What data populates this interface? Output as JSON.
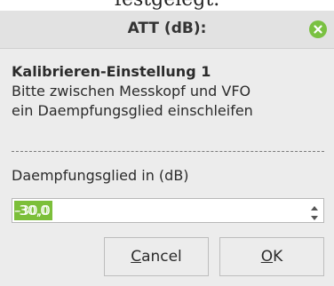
{
  "background_text": "festgelegt.",
  "dialog": {
    "title": "ATT (dB):",
    "heading": "Kalibrieren-Einstellung 1",
    "message_line1": "Bitte zwischen Messkopf und VFO",
    "message_line2": "ein Daempfungsglied einschleifen",
    "field_label": "Daempfungsglied in (dB)",
    "field_value": "-30,0",
    "buttons": {
      "cancel_mnemonic": "C",
      "cancel_rest": "ancel",
      "ok_mnemonic": "O",
      "ok_rest": "K"
    }
  },
  "colors": {
    "accent": "#7cbf3a",
    "close_button": "#7ac142"
  },
  "icons": {
    "close": "close-icon",
    "spin_up": "arrow-up-icon",
    "spin_down": "arrow-down-icon"
  }
}
